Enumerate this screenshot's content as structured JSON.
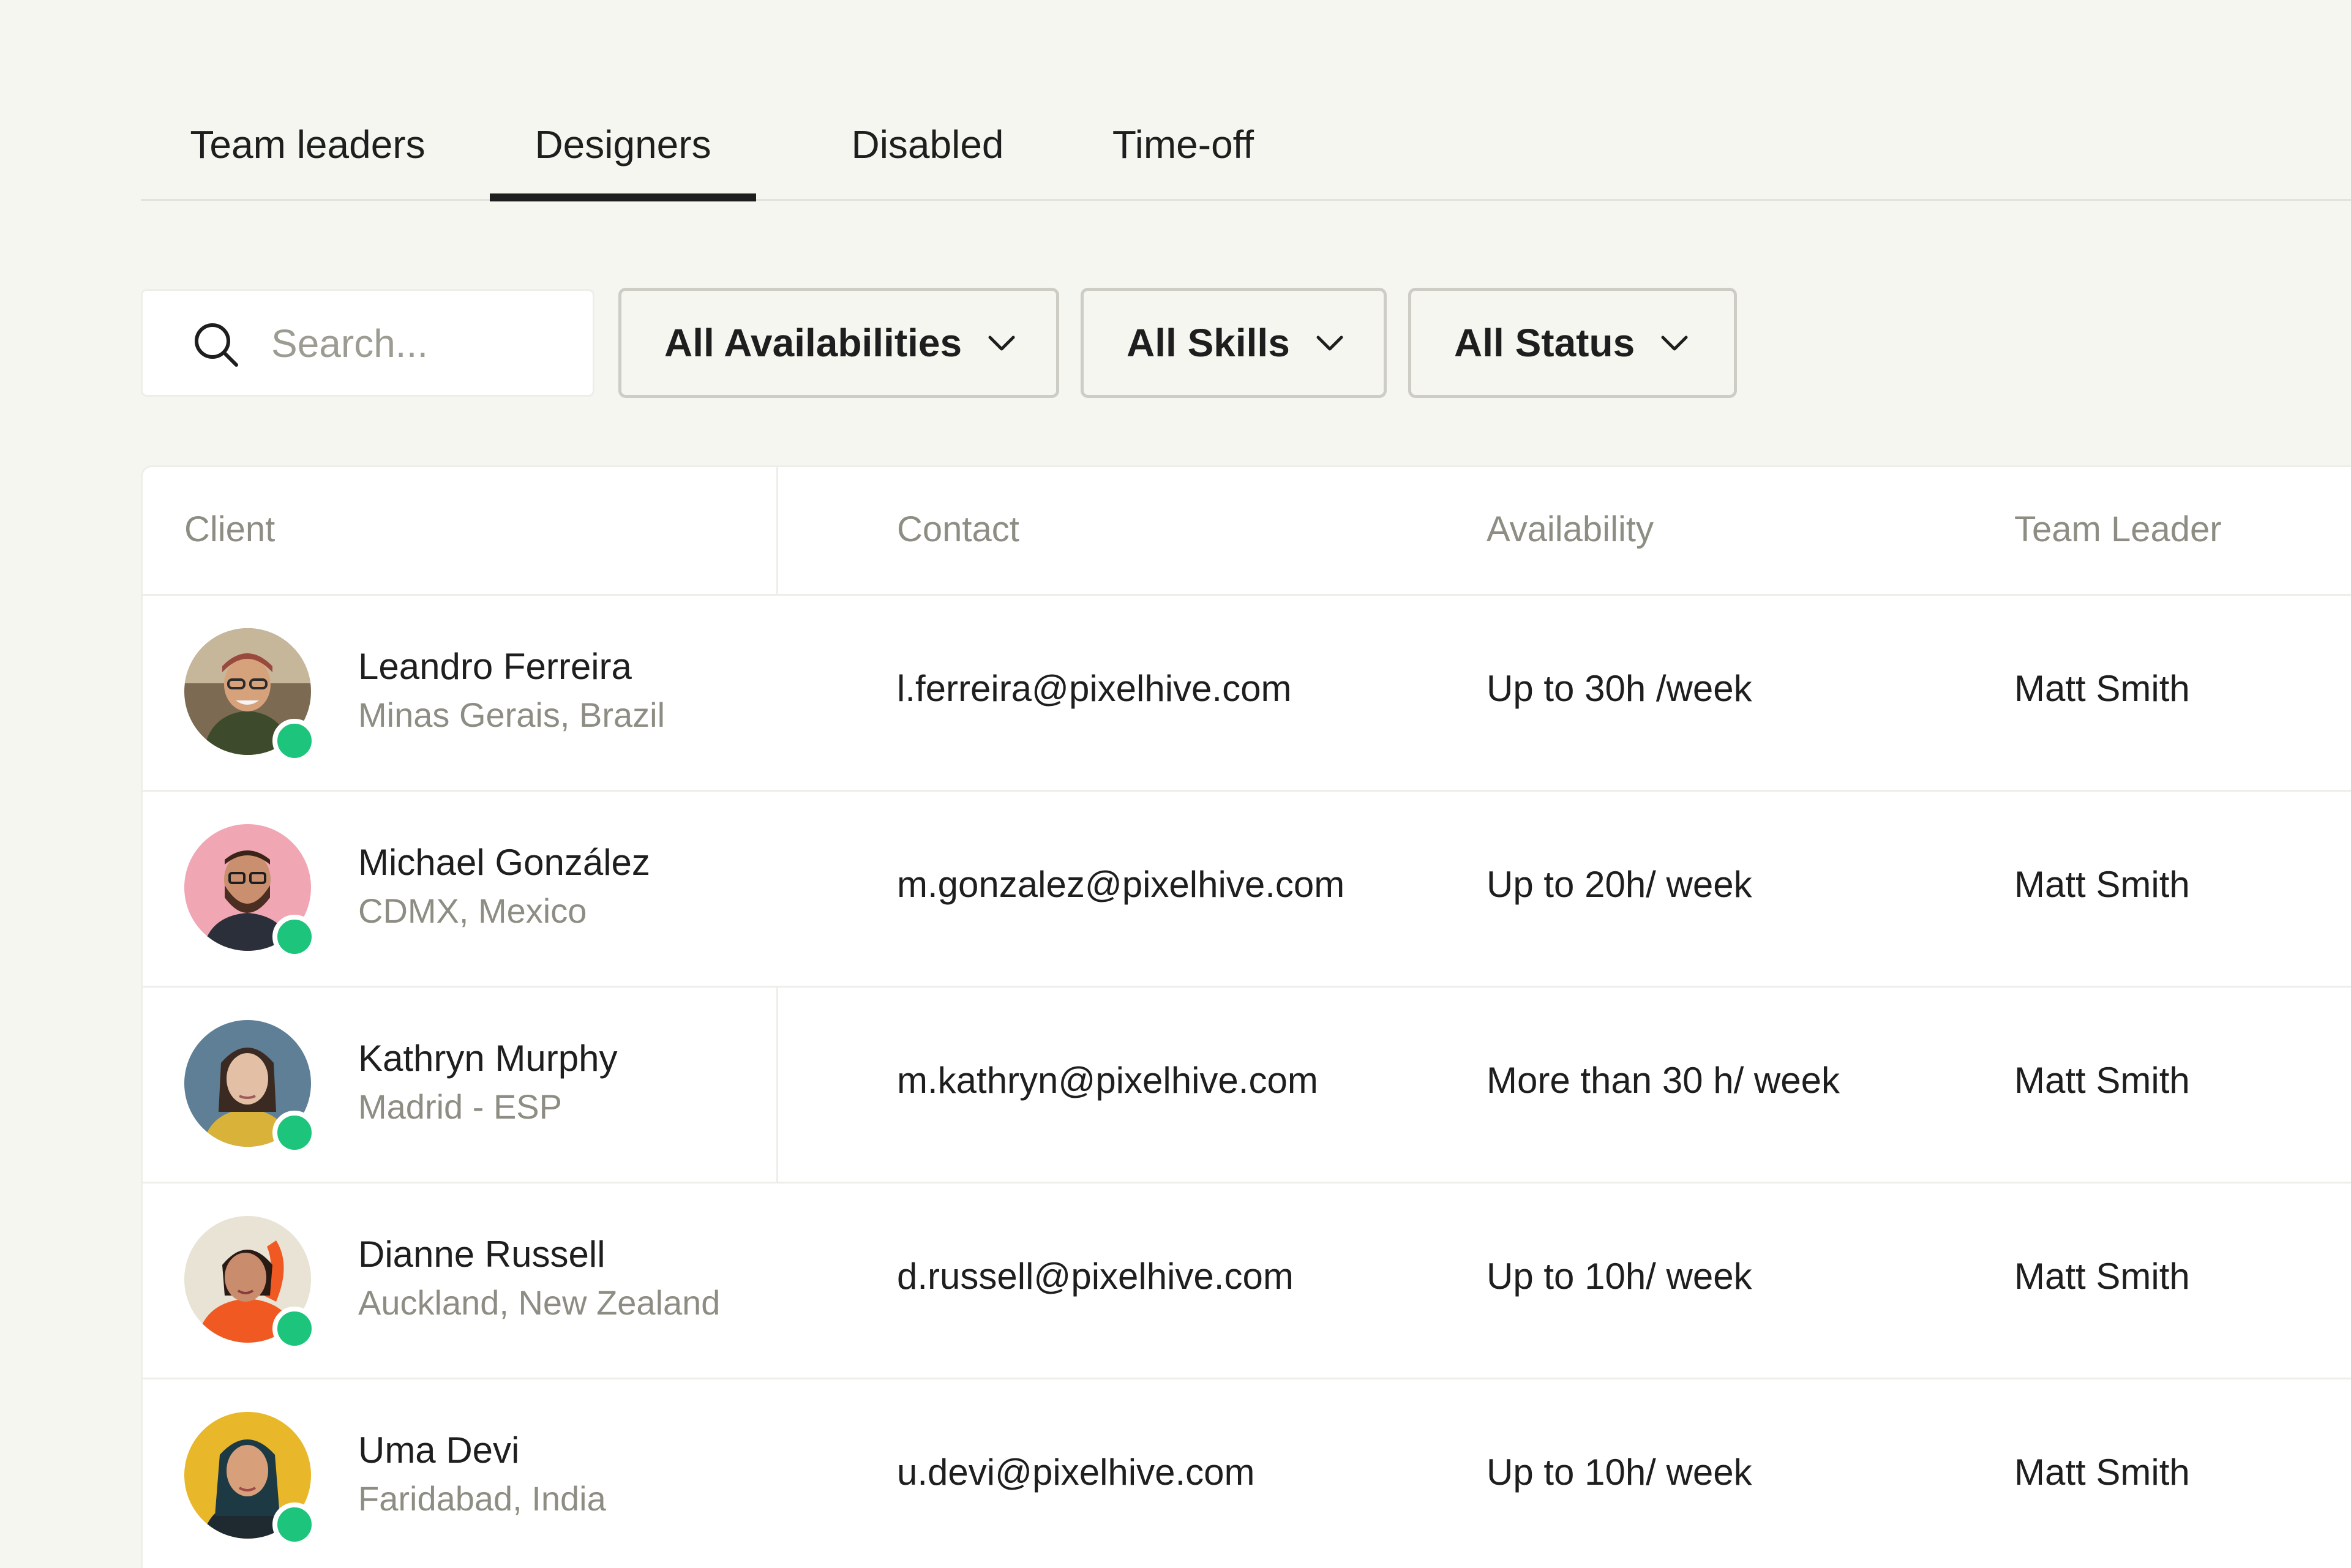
{
  "tabs": [
    {
      "label": "Team leaders",
      "active": false
    },
    {
      "label": "Designers",
      "active": true
    },
    {
      "label": "Disabled",
      "active": false
    },
    {
      "label": "Time-off",
      "active": false
    }
  ],
  "search": {
    "placeholder": "Search...",
    "icon": "search-icon"
  },
  "filters": {
    "availability": "All Availabilities",
    "skills": "All Skills",
    "status": "All Status",
    "icon": "chevron-down-icon"
  },
  "table": {
    "columns": {
      "client": "Client",
      "contact": "Contact",
      "availability": "Availability",
      "team_leader": "Team Leader"
    },
    "rows": [
      {
        "name": "Leandro Ferreira",
        "location": "Minas Gerais, Brazil",
        "email": "l.ferreira@pixelhive.com",
        "availability": "Up to 30h /week",
        "team_leader": "Matt Smith",
        "online": true
      },
      {
        "name": "Michael González",
        "location": "CDMX, Mexico",
        "email": "m.gonzalez@pixelhive.com",
        "availability": "Up to 20h/ week",
        "team_leader": "Matt Smith",
        "online": true
      },
      {
        "name": "Kathryn Murphy",
        "location": "Madrid - ESP",
        "email": "m.kathryn@pixelhive.com",
        "availability": "More than 30 h/ week",
        "team_leader": "Matt Smith",
        "online": true
      },
      {
        "name": "Dianne Russell",
        "location": "Auckland, New Zealand",
        "email": "d.russell@pixelhive.com",
        "availability": "Up to 10h/ week",
        "team_leader": "Matt Smith",
        "online": true
      },
      {
        "name": "Uma Devi",
        "location": "Faridabad, India",
        "email": "u.devi@pixelhive.com",
        "availability": "Up to 10h/ week",
        "team_leader": "Matt Smith",
        "online": true
      }
    ]
  },
  "colors": {
    "background": "#f6f6f1",
    "text": "#1e1e1e",
    "muted": "#8d8d83",
    "online": "#1cc47c"
  }
}
